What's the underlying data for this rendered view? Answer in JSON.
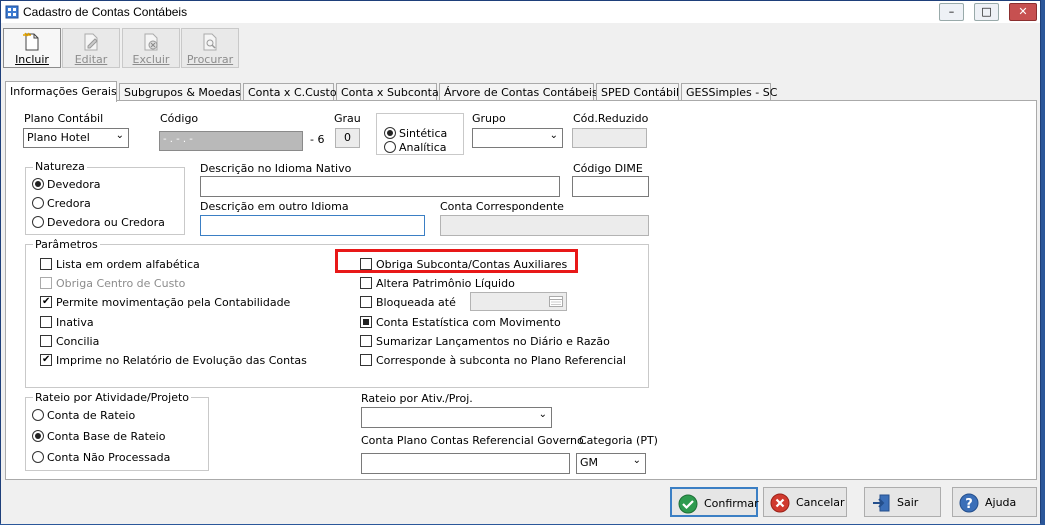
{
  "window": {
    "title": "Cadastro de Contas Contábeis",
    "min_glyph": "–",
    "max_glyph": "□",
    "close_glyph": "✕"
  },
  "toolbar": {
    "incluir": "Incluir",
    "editar": "Editar",
    "excluir": "Excluir",
    "procurar": "Procurar"
  },
  "tabs": [
    "Informações Gerais",
    "Subgrupos & Moedas",
    "Conta x C.Custo",
    "Conta x Subconta",
    "Árvore de Contas Contábeis",
    "SPED Contábil",
    "GESSimples - SC"
  ],
  "form": {
    "plano_label": "Plano Contábil",
    "plano_value": "Plano Hotel",
    "codigo_label": "Código",
    "codigo_value": "- . - . -",
    "codigo_suffix": "- 6",
    "grau_label": "Grau",
    "grau_value": "0",
    "tipo_sintetica": "Sintética",
    "tipo_analitica": "Analítica",
    "grupo_label": "Grupo",
    "grupo_value": "",
    "cod_reduzido_label": "Cód.Reduzido",
    "cod_reduzido_value": "",
    "natureza_title": "Natureza",
    "natureza_devedora": "Devedora",
    "natureza_credora": "Credora",
    "natureza_ambas": "Devedora ou Credora",
    "desc_nativo_label": "Descrição no Idioma Nativo",
    "desc_nativo_value": "",
    "codigo_dime_label": "Código DIME",
    "codigo_dime_value": "",
    "desc_outro_label": "Descrição em outro Idioma",
    "desc_outro_value": "",
    "conta_corresp_label": "Conta Correspondente",
    "conta_corresp_value": ""
  },
  "parametros": {
    "title": "Parâmetros",
    "left": [
      {
        "label": "Lista em ordem alfabética",
        "state": "unchecked"
      },
      {
        "label": "Obriga Centro de Custo",
        "state": "disabled"
      },
      {
        "label": "Permite movimentação pela Contabilidade",
        "state": "checked"
      },
      {
        "label": "Inativa",
        "state": "unchecked"
      },
      {
        "label": "Concilia",
        "state": "unchecked"
      },
      {
        "label": "Imprime no Relatório de Evolução das Contas",
        "state": "checked"
      }
    ],
    "right": [
      {
        "label": "Obriga Subconta/Contas Auxiliares",
        "state": "unchecked"
      },
      {
        "label": "Altera Patrimônio Líquido",
        "state": "unchecked"
      },
      {
        "label": "Bloqueada até",
        "state": "unchecked"
      },
      {
        "label": "Conta Estatística com Movimento",
        "state": "indeterminate"
      },
      {
        "label": "Sumarizar Lançamentos no Diário e Razão",
        "state": "unchecked"
      },
      {
        "label": "Corresponde à subconta no Plano Referencial",
        "state": "unchecked"
      }
    ]
  },
  "rateio": {
    "title": "Rateio por Atividade/Projeto",
    "opt1": "Conta de Rateio",
    "opt2": "Conta Base de Rateio",
    "opt3": "Conta Não Processada",
    "ativ_label": "Rateio por Ativ./Proj.",
    "ativ_value": "",
    "plano_ref_label": "Conta Plano Contas Referencial Governo",
    "plano_ref_value": "",
    "categoria_label": "Categoria (PT)",
    "categoria_value": "GM"
  },
  "footer": {
    "confirmar": "Confirmar",
    "cancelar": "Cancelar",
    "sair": "Sair",
    "ajuda": "Ajuda"
  },
  "colors": {
    "highlight": "#e81818",
    "accent": "#3b7fc4"
  }
}
